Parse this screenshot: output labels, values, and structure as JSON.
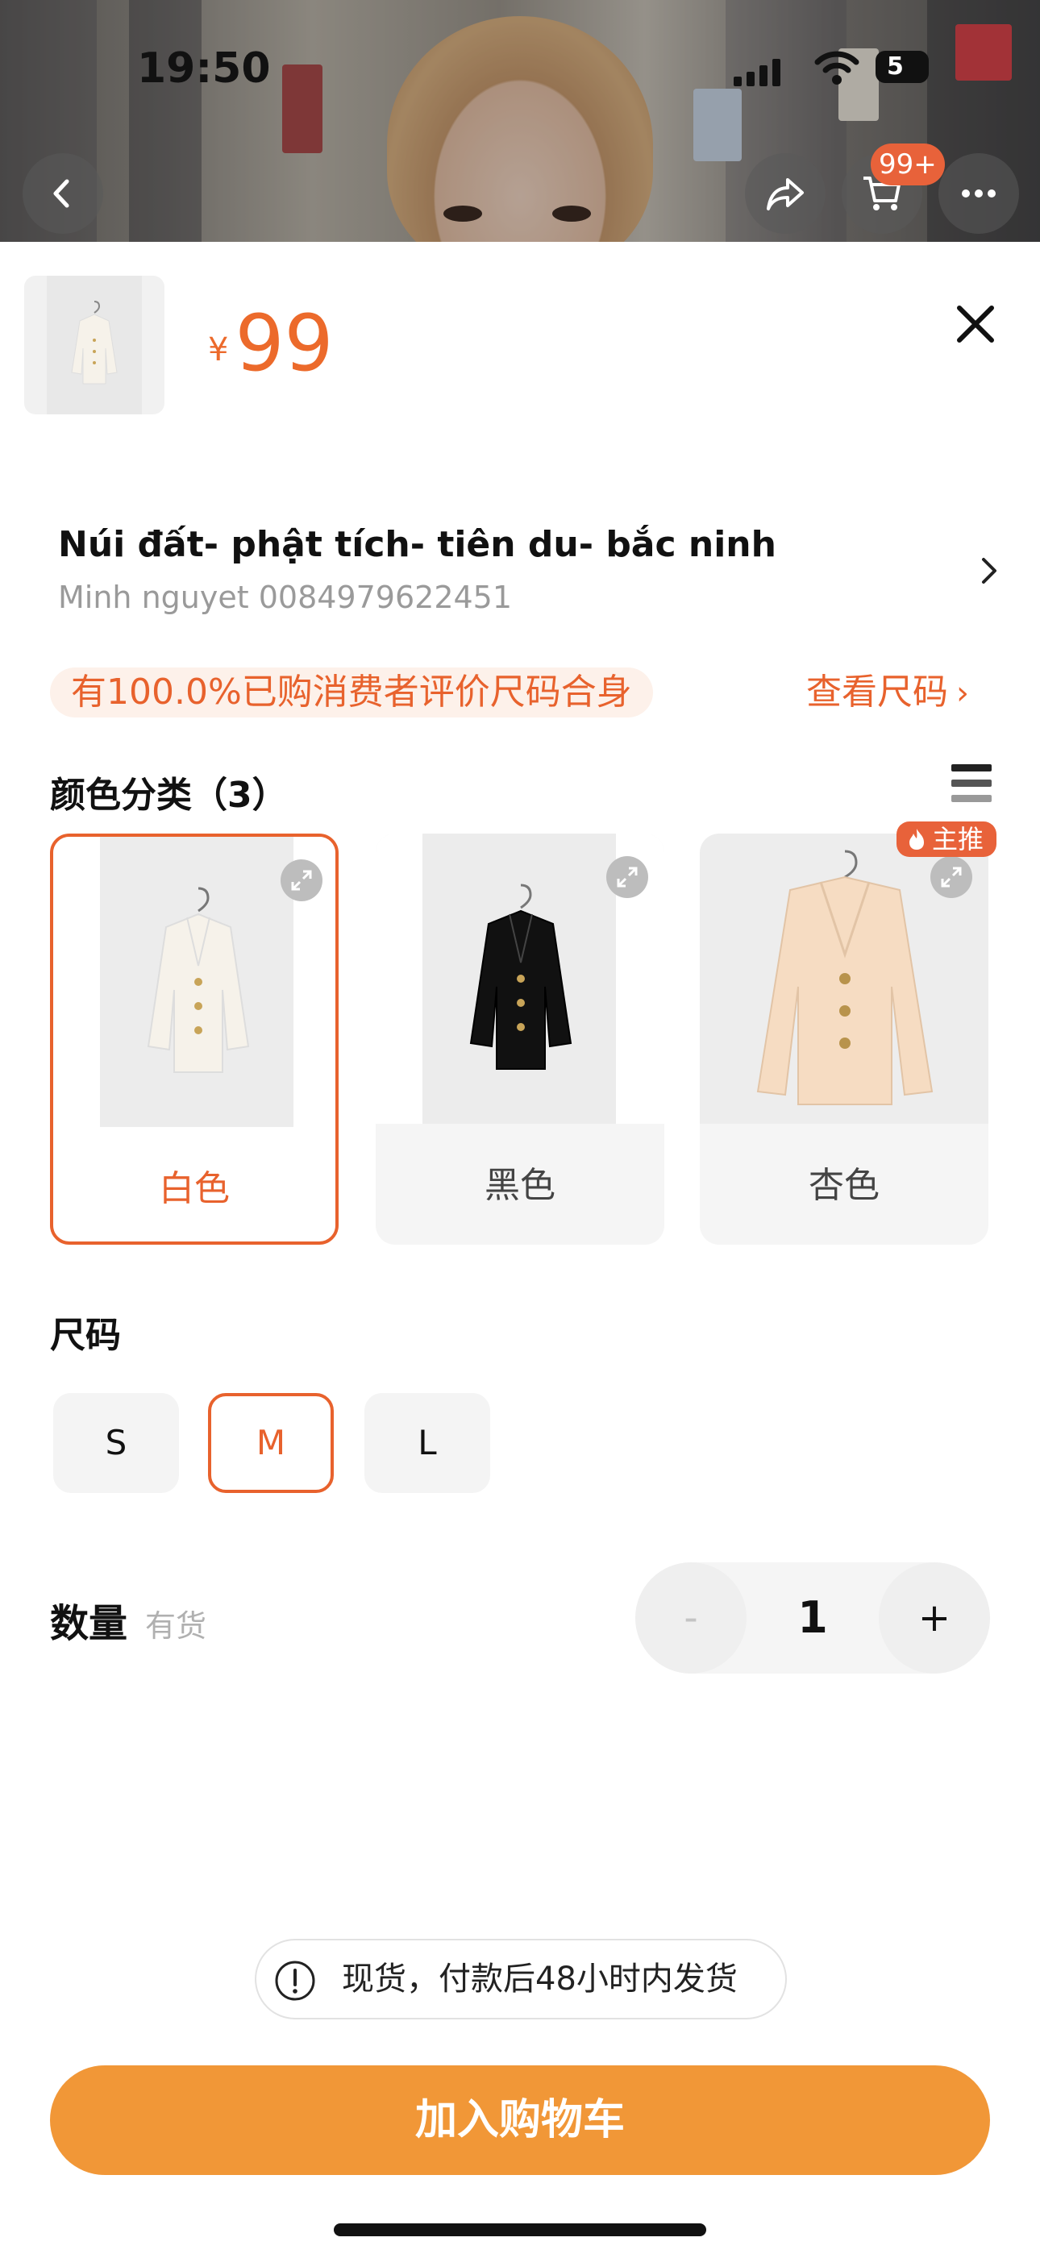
{
  "status_bar": {
    "time": "19:50",
    "battery": "5"
  },
  "nav": {
    "cart_badge": "99+"
  },
  "product": {
    "currency": "¥",
    "price": "99"
  },
  "address": {
    "line1": "Núi đất- phật tích- tiên du- bắc ninh",
    "line2": "Minh nguyet 0084979622451"
  },
  "fit_info": {
    "text": "有100.0%已购消费者评价尺码合身",
    "size_link": "查看尺码",
    "chevron": "›"
  },
  "colors": {
    "label": "颜色分类（3）",
    "hot_badge": "主推",
    "items": [
      {
        "name": "白色",
        "selected": true,
        "garment_color": "#f6f2ea"
      },
      {
        "name": "黑色",
        "selected": false,
        "garment_color": "#111111"
      },
      {
        "name": "杏色",
        "selected": false,
        "garment_color": "#f6dcc2"
      }
    ]
  },
  "sizes": {
    "label": "尺码",
    "items": [
      {
        "name": "S",
        "selected": false
      },
      {
        "name": "M",
        "selected": true
      },
      {
        "name": "L",
        "selected": false
      }
    ]
  },
  "quantity": {
    "label": "数量",
    "stock": "有货",
    "minus": "-",
    "value": "1",
    "plus": "+"
  },
  "notice": {
    "text": "现货，付款后48小时内发货"
  },
  "cta": {
    "label": "加入购物车"
  },
  "theme": {
    "accent": "#e8622d",
    "cta": "#f19737"
  }
}
